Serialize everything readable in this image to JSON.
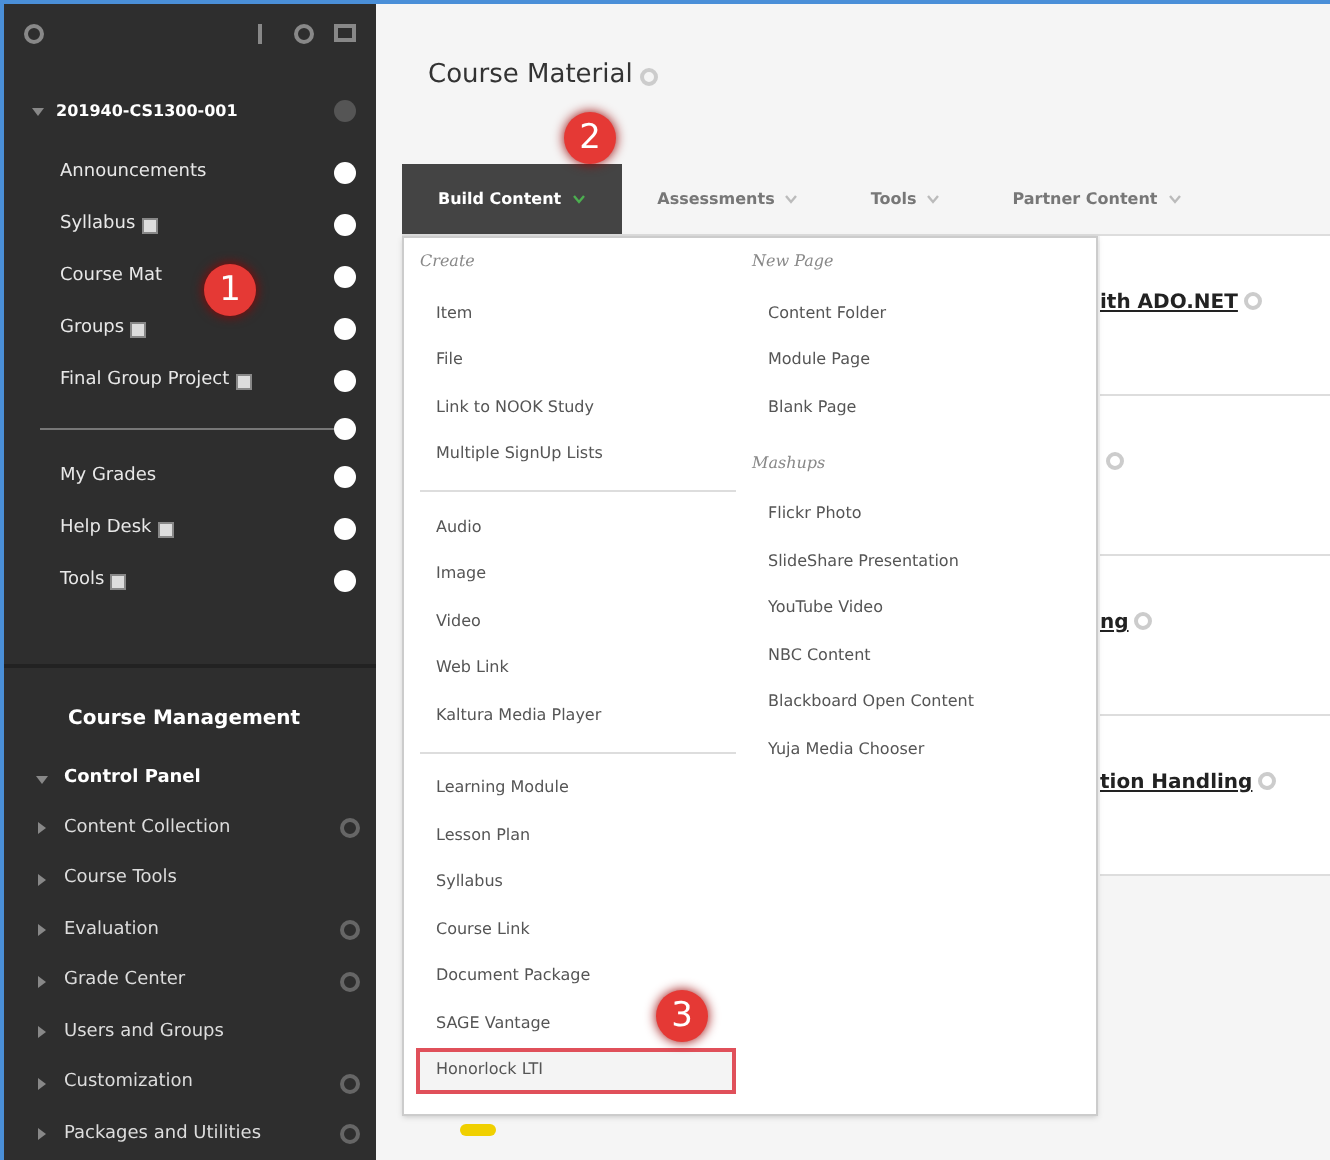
{
  "course": {
    "title": "201940-CS1300-001",
    "expanded": true
  },
  "course_menu": [
    {
      "label": "Announcements",
      "page_icon": false
    },
    {
      "label": "Syllabus",
      "page_icon": true
    },
    {
      "label": "Course Mat",
      "page_icon": false
    },
    {
      "label": "Groups",
      "page_icon": true
    },
    {
      "label": "Final Group Project",
      "page_icon": true
    },
    {
      "kind": "divider"
    },
    {
      "label": "My Grades",
      "page_icon": false
    },
    {
      "label": "Help Desk",
      "page_icon": true
    },
    {
      "label": "Tools",
      "page_icon": true
    }
  ],
  "management": {
    "title": "Course Management",
    "panel": "Control Panel",
    "items": [
      {
        "label": "Content Collection",
        "gear": true
      },
      {
        "label": "Course Tools",
        "gear": false
      },
      {
        "label": "Evaluation",
        "gear": true
      },
      {
        "label": "Grade Center",
        "gear": true
      },
      {
        "label": "Users and Groups",
        "gear": false
      },
      {
        "label": "Customization",
        "gear": true
      },
      {
        "label": "Packages and Utilities",
        "gear": true
      }
    ]
  },
  "page_title": "Course Material",
  "tabs": [
    {
      "label": "Build Content",
      "selected": true
    },
    {
      "label": "Assessments",
      "selected": false
    },
    {
      "label": "Tools",
      "selected": false
    },
    {
      "label": "Partner Content",
      "selected": false
    }
  ],
  "menu": {
    "columns": [
      [
        {
          "heading": "Create",
          "items": [
            {
              "label": "Item",
              "highlighted": false
            },
            {
              "label": "File",
              "highlighted": false
            },
            {
              "label": "Link to NOOK Study",
              "highlighted": false
            },
            {
              "label": "Multiple SignUp Lists",
              "highlighted": false
            }
          ]
        },
        {
          "items": [
            {
              "label": "Audio",
              "highlighted": false
            },
            {
              "label": "Image",
              "highlighted": false
            },
            {
              "label": "Video",
              "highlighted": false
            },
            {
              "label": "Web Link",
              "highlighted": false
            },
            {
              "label": "Kaltura Media Player",
              "highlighted": false
            }
          ]
        },
        {
          "items": [
            {
              "label": "Learning Module",
              "highlighted": false
            },
            {
              "label": "Lesson Plan",
              "highlighted": false
            },
            {
              "label": "Syllabus",
              "highlighted": false
            },
            {
              "label": "Course Link",
              "highlighted": false
            },
            {
              "label": "Document Package",
              "highlighted": false
            },
            {
              "label": "SAGE Vantage",
              "highlighted": false
            },
            {
              "label": "Honorlock LTI",
              "highlighted": true
            }
          ]
        }
      ],
      [
        {
          "heading": "New Page",
          "items": [
            {
              "label": "Content Folder",
              "highlighted": false
            },
            {
              "label": "Module Page",
              "highlighted": false
            },
            {
              "label": "Blank Page",
              "highlighted": false
            }
          ]
        },
        {
          "heading": "Mashups",
          "items": [
            {
              "label": "Flickr Photo",
              "highlighted": false
            },
            {
              "label": "SlideShare Presentation",
              "highlighted": false
            },
            {
              "label": "YouTube Video",
              "highlighted": false
            },
            {
              "label": "NBC Content",
              "highlighted": false
            },
            {
              "label": "Blackboard Open Content",
              "highlighted": false
            },
            {
              "label": "Yuja Media Chooser",
              "highlighted": false
            }
          ]
        }
      ]
    ]
  },
  "content_items": [
    {
      "kind": "titled",
      "title": "ith ADO.NET"
    },
    {
      "kind": "untitled"
    },
    {
      "kind": "titled",
      "title": "ng"
    },
    {
      "kind": "titled",
      "title": "tion Handling"
    }
  ],
  "callouts": [
    "1",
    "2",
    "3"
  ]
}
